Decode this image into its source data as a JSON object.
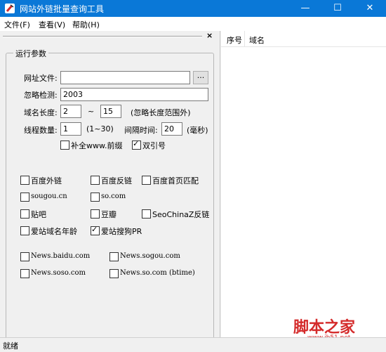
{
  "window": {
    "title": "网站外链批量查询工具",
    "controls": {
      "minimize": "—",
      "maximize": "☐",
      "close": "✕"
    }
  },
  "menu": [
    "文件(F)",
    "查看(V)",
    "帮助(H)"
  ],
  "pane": {
    "close_glyph": "×"
  },
  "params": {
    "group_title": "运行参数",
    "url_file": {
      "label": "网址文件:",
      "value": "",
      "browse": "..."
    },
    "ignore": {
      "label": "忽略检测:",
      "value": "2003"
    },
    "domain_len": {
      "label": "域名长度:",
      "min": "2",
      "sep": "~",
      "max": "15",
      "note": "(忽略长度范围外)"
    },
    "threads": {
      "label": "线程数量:",
      "value": "1",
      "range": "(1~30)",
      "interval_label": "间隔时间:",
      "interval": "20",
      "unit": "(毫秒)"
    },
    "prefix": {
      "label": "补全www.前缀",
      "checked": false
    },
    "quotes": {
      "label": "双引号",
      "checked": true
    }
  },
  "engines": [
    {
      "label": "百度外链",
      "checked": false
    },
    {
      "label": "百度反链",
      "checked": false
    },
    {
      "label": "百度首页匹配",
      "checked": false
    },
    {
      "label": "sougou.cn",
      "checked": false
    },
    {
      "label": "so.com",
      "checked": false
    },
    {
      "label": "贴吧",
      "checked": false
    },
    {
      "label": "豆瓣",
      "checked": false
    },
    {
      "label": "SeoChinaZ反链",
      "checked": false
    },
    {
      "label": "爱站域名年龄",
      "checked": false
    },
    {
      "label": "爱站搜狗PR",
      "checked": true
    }
  ],
  "news": [
    {
      "label": "News.baidu.com",
      "checked": false
    },
    {
      "label": "News.sogou.com",
      "checked": false
    },
    {
      "label": "News.soso.com",
      "checked": false
    },
    {
      "label": "News.so.com (btime)",
      "checked": false
    }
  ],
  "table": {
    "columns": [
      "序号",
      "域名"
    ]
  },
  "status": "就绪",
  "watermark": {
    "brand": "脚本之家",
    "url": "www.jb51.net"
  },
  "colors": {
    "titlebar": "#0a78d7",
    "watermark": "#d42b2b"
  }
}
